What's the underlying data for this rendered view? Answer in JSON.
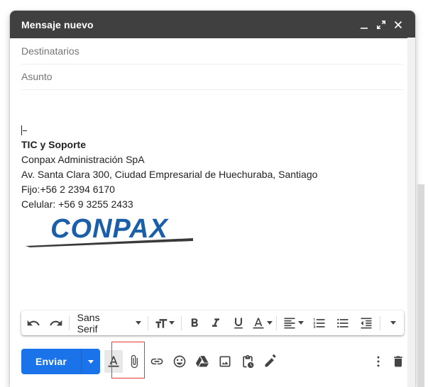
{
  "window": {
    "title": "Mensaje nuevo",
    "controls": [
      "minimize-icon",
      "expand-icon",
      "close-icon"
    ]
  },
  "fields": {
    "recipients_placeholder": "Destinatarios",
    "subject_placeholder": "Asunto"
  },
  "signature": {
    "line1": "TIC y Soporte",
    "line2": "Conpax Administración SpA",
    "line3": "Av. Santa Clara 300, Ciudad Empresarial de Huechuraba, Santiago",
    "line4": "Fijo:+56  2 2394 6170",
    "line5": "Celular: +56 9 3255 2433",
    "logo_text": "CONPAX"
  },
  "formatting": {
    "font": "Sans Serif",
    "buttons": [
      "undo-icon",
      "redo-icon",
      "font-size-icon",
      "bold-icon",
      "italic-icon",
      "underline-icon",
      "text-color-icon",
      "align-icon",
      "numbered-list-icon",
      "bulleted-list-icon",
      "indent-less-icon",
      "more-formatting-icon"
    ]
  },
  "actions": {
    "send_label": "Enviar",
    "icons": [
      "formatting-options-icon",
      "attach-icon",
      "link-icon",
      "emoji-icon",
      "drive-icon",
      "photo-icon",
      "confidential-icon",
      "signature-icon",
      "more-options-icon",
      "delete-icon"
    ]
  },
  "colors": {
    "titlebar": "#404040",
    "send_button": "#1a73e8",
    "logo_blue": "#1b5fa8",
    "highlight": "#e53935"
  }
}
